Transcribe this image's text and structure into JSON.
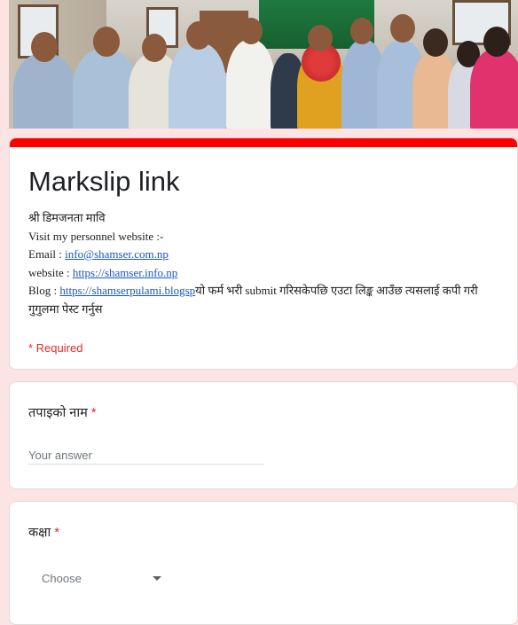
{
  "form": {
    "title": "Markslip link",
    "desc_line1": "श्री डिमजनता मावि",
    "desc_line2": "Visit my personnel  website :-",
    "email_label": "Email : ",
    "email_link": "info@shamser.com.np",
    "website_label": "website : ",
    "website_link": "https://shamser.info.np",
    "blog_label": "Blog : ",
    "blog_link": "https://shamserpulami.blogsp",
    "blog_tail": "यो फर्म भरी submit गरिसकेपछि एउटा लिङ्क आउँछ त्यसलाई कपी गरी गुगुलमा पेस्ट गर्नुस",
    "required_note": "* Required",
    "accent_color": "#ff0000"
  },
  "questions": {
    "name": {
      "label": "तपाइको नाम",
      "required_mark": "*",
      "placeholder": "Your answer"
    },
    "class": {
      "label": "कक्षा",
      "required_mark": "*",
      "selected": "Choose",
      "icon": "dropdown-arrow-icon"
    }
  },
  "banner": {
    "icon": "group-photo-banner"
  }
}
